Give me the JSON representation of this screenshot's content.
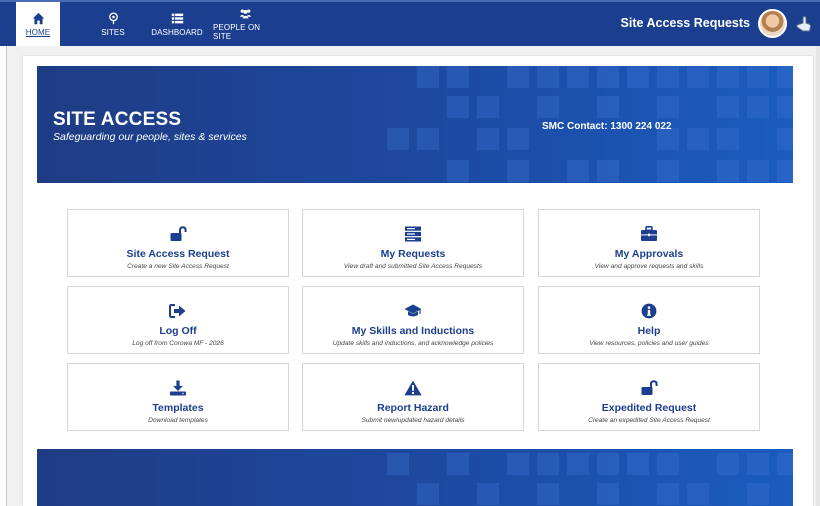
{
  "nav": {
    "tabs": [
      {
        "label": "HOME",
        "icon": "home-icon",
        "active": true
      },
      {
        "label": "SITES",
        "icon": "map-pin-icon"
      },
      {
        "label": "DASHBOARD",
        "icon": "list-icon"
      },
      {
        "label": "PEOPLE ON SITE",
        "icon": "people-icon"
      }
    ],
    "app_title": "Site Access Requests"
  },
  "banner": {
    "title": "SITE ACCESS",
    "subtitle": "Safeguarding our people, sites & services",
    "contact": "SMC Contact: 1300 224 022"
  },
  "tiles": [
    {
      "title": "Site Access Request",
      "desc": "Create a new Site Access Request",
      "icon": "unlock-icon"
    },
    {
      "title": "My Requests",
      "desc": "View draft and submitted Site Access Requests",
      "icon": "server-icon"
    },
    {
      "title": "My Approvals",
      "desc": "View and approve requests and skills",
      "icon": "briefcase-icon"
    },
    {
      "title": "Log Off",
      "desc": "Log off from Corowa MF - 2026",
      "icon": "sign-out-icon"
    },
    {
      "title": "My Skills and Inductions",
      "desc": "Update skills and inductions, and acknowledge policies",
      "icon": "graduation-cap-icon"
    },
    {
      "title": "Help",
      "desc": "View resources, policies and user guides",
      "icon": "info-icon"
    },
    {
      "title": "Templates",
      "desc": "Download templates",
      "icon": "download-icon"
    },
    {
      "title": "Report Hazard",
      "desc": "Submit new/updated hazard details",
      "icon": "warning-icon"
    },
    {
      "title": "Expedited Request",
      "desc": "Create an expedited Site Access Request",
      "icon": "unlock-icon"
    }
  ],
  "colors": {
    "brand": "#1b3f8e",
    "banner": "#1d4aa2"
  }
}
